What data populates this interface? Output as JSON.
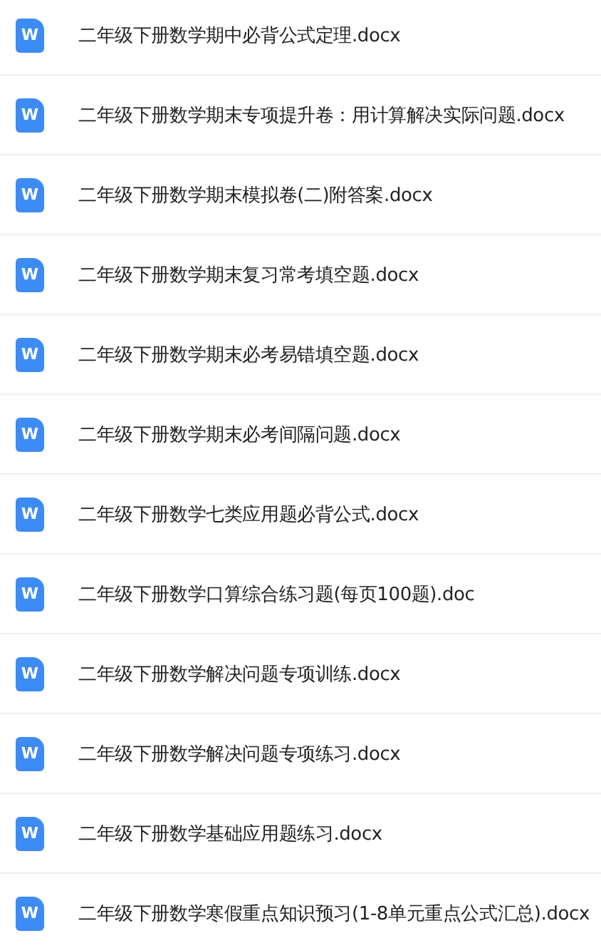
{
  "files": [
    {
      "icon_letter": "W",
      "name": "二年级下册数学期中必背公式定理.docx"
    },
    {
      "icon_letter": "W",
      "name": "二年级下册数学期末专项提升卷：用计算解决实际问题.docx"
    },
    {
      "icon_letter": "W",
      "name": "二年级下册数学期末模拟卷(二)附答案.docx"
    },
    {
      "icon_letter": "W",
      "name": "二年级下册数学期末复习常考填空题.docx"
    },
    {
      "icon_letter": "W",
      "name": "二年级下册数学期末必考易错填空题.docx"
    },
    {
      "icon_letter": "W",
      "name": "二年级下册数学期末必考间隔问题.docx"
    },
    {
      "icon_letter": "W",
      "name": "二年级下册数学七类应用题必背公式.docx"
    },
    {
      "icon_letter": "W",
      "name": "二年级下册数学口算综合练习题(每页100题).doc"
    },
    {
      "icon_letter": "W",
      "name": "二年级下册数学解决问题专项训练.docx"
    },
    {
      "icon_letter": "W",
      "name": "二年级下册数学解决问题专项练习.docx"
    },
    {
      "icon_letter": "W",
      "name": "二年级下册数学基础应用题练习.docx"
    },
    {
      "icon_letter": "W",
      "name": "二年级下册数学寒假重点知识预习(1-8单元重点公式汇总).docx"
    }
  ]
}
